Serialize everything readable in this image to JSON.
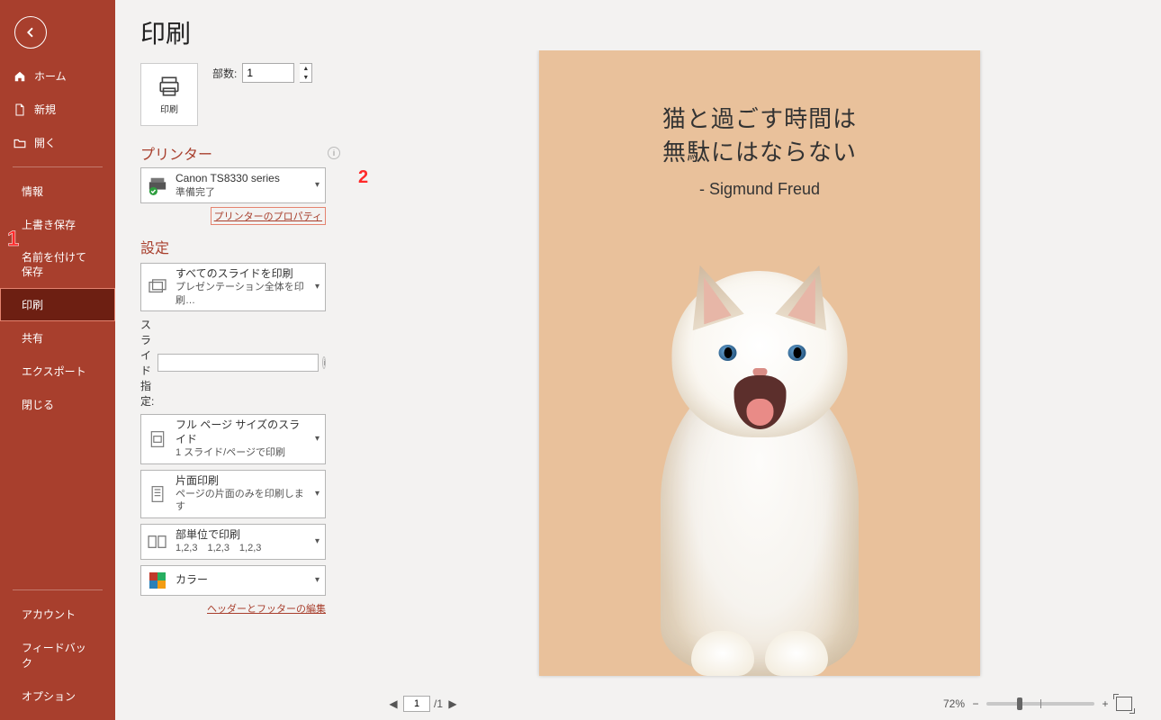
{
  "page_title": "印刷",
  "sidebar": {
    "items": [
      {
        "label": "ホーム",
        "icon": "home"
      },
      {
        "label": "新規",
        "icon": "file"
      },
      {
        "label": "開く",
        "icon": "folder"
      }
    ],
    "text_items": [
      {
        "label": "情報"
      },
      {
        "label": "上書き保存"
      },
      {
        "label": "名前を付けて保存",
        "two_line": true
      },
      {
        "label": "印刷",
        "selected": true
      },
      {
        "label": "共有"
      },
      {
        "label": "エクスポート"
      },
      {
        "label": "閉じる"
      }
    ],
    "bottom": [
      {
        "label": "アカウント"
      },
      {
        "label": "フィードバック"
      },
      {
        "label": "オプション"
      }
    ]
  },
  "print_button_label": "印刷",
  "copies": {
    "label": "部数:",
    "value": "1"
  },
  "printer": {
    "header": "プリンター",
    "name": "Canon TS8330 series",
    "status": "準備完了",
    "properties_link": "プリンターのプロパティ"
  },
  "settings": {
    "header": "設定",
    "items": [
      {
        "title": "すべてのスライドを印刷",
        "sub": "プレゼンテーション全体を印刷…",
        "icon": "slides-all"
      },
      {
        "title": "フル ページ サイズのスライド",
        "sub": "1 スライド/ページで印刷",
        "icon": "full-page"
      },
      {
        "title": "片面印刷",
        "sub": "ページの片面のみを印刷します",
        "icon": "one-side"
      },
      {
        "title": "部単位で印刷",
        "sub": "1,2,3　1,2,3　1,2,3",
        "icon": "collate"
      },
      {
        "title": "カラー",
        "sub": "",
        "icon": "color"
      }
    ],
    "slide_label": "スライド指定:",
    "header_footer_link": "ヘッダーとフッターの編集"
  },
  "slide_preview": {
    "line1": "猫と過ごす時間は",
    "line2": "無駄にはならない",
    "author": "- Sigmund Freud"
  },
  "status": {
    "current_page": "1",
    "total_pages": "/1",
    "zoom": "72%"
  },
  "annotations": {
    "one": "1",
    "two": "2"
  }
}
